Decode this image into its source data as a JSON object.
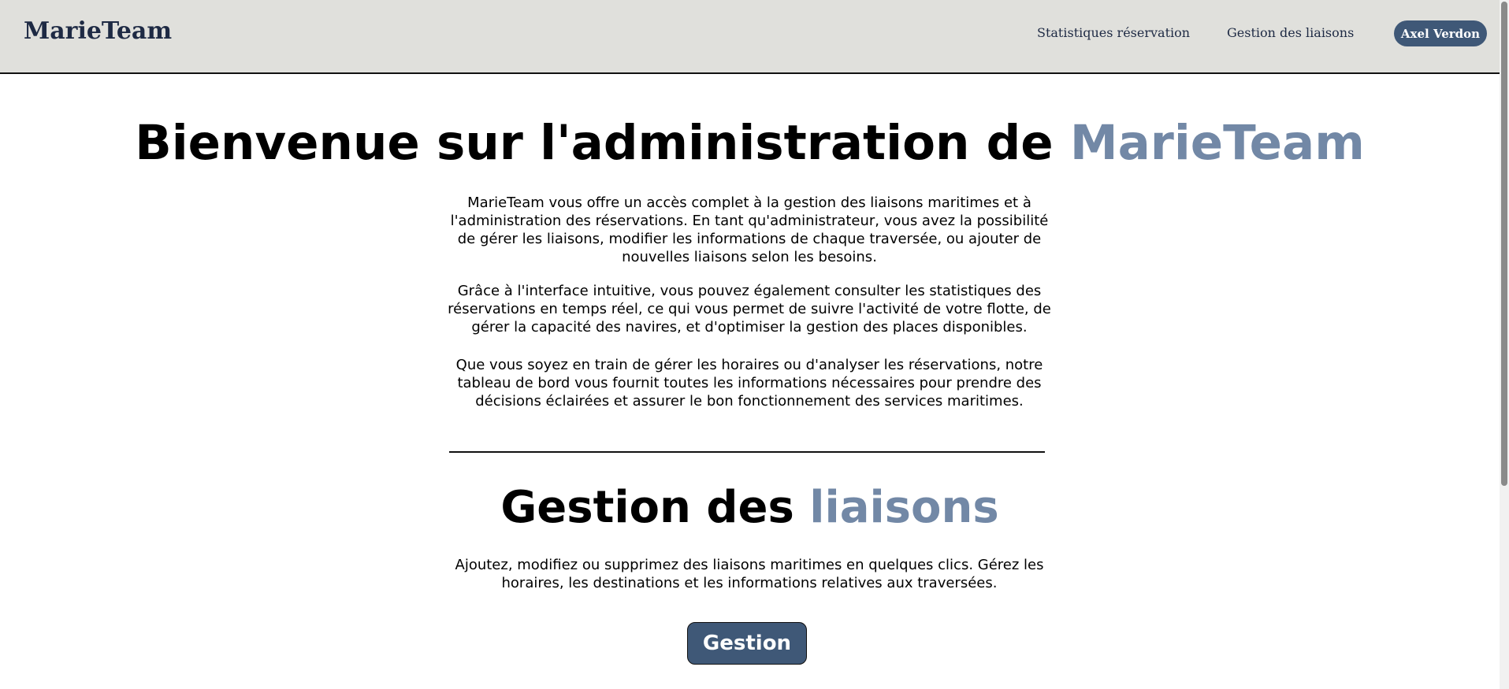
{
  "header": {
    "logo": "MarieTeam",
    "nav": [
      "Statistiques réservation",
      "Gestion des liaisons"
    ],
    "user": "Axel Verdon"
  },
  "welcome": {
    "title_prefix": "Bienvenue sur l'administration de ",
    "title_accent": "MarieTeam",
    "paragraphs": [
      "MarieTeam vous offre un accès complet à la gestion des liaisons maritimes et à l'administration des réservations. En tant qu'administrateur, vous avez la possibilité de gérer les liaisons, modifier les informations de chaque traversée, ou ajouter de nouvelles liaisons selon les besoins.",
      "Grâce à l'interface intuitive, vous pouvez également consulter les statistiques des réservations en temps réel, ce qui vous permet de suivre l'activité de votre flotte, de gérer la capacité des navires, et d'optimiser la gestion des places disponibles.",
      "Que vous soyez en train de gérer les horaires ou d'analyser les réservations, notre tableau de bord vous fournit toutes les informations nécessaires pour prendre des décisions éclairées et assurer le bon fonctionnement des services maritimes."
    ]
  },
  "section": {
    "title_prefix": "Gestion des ",
    "title_accent": "liaisons",
    "text": "Ajoutez, modifiez ou supprimez des liaisons maritimes en quelques clics. Gérez les horaires, les destinations et les informations relatives aux traversées.",
    "button": "Gestion"
  },
  "colors": {
    "accent": "#7288a6",
    "button": "#3f5877",
    "header_bg": "#e0e0dc"
  }
}
